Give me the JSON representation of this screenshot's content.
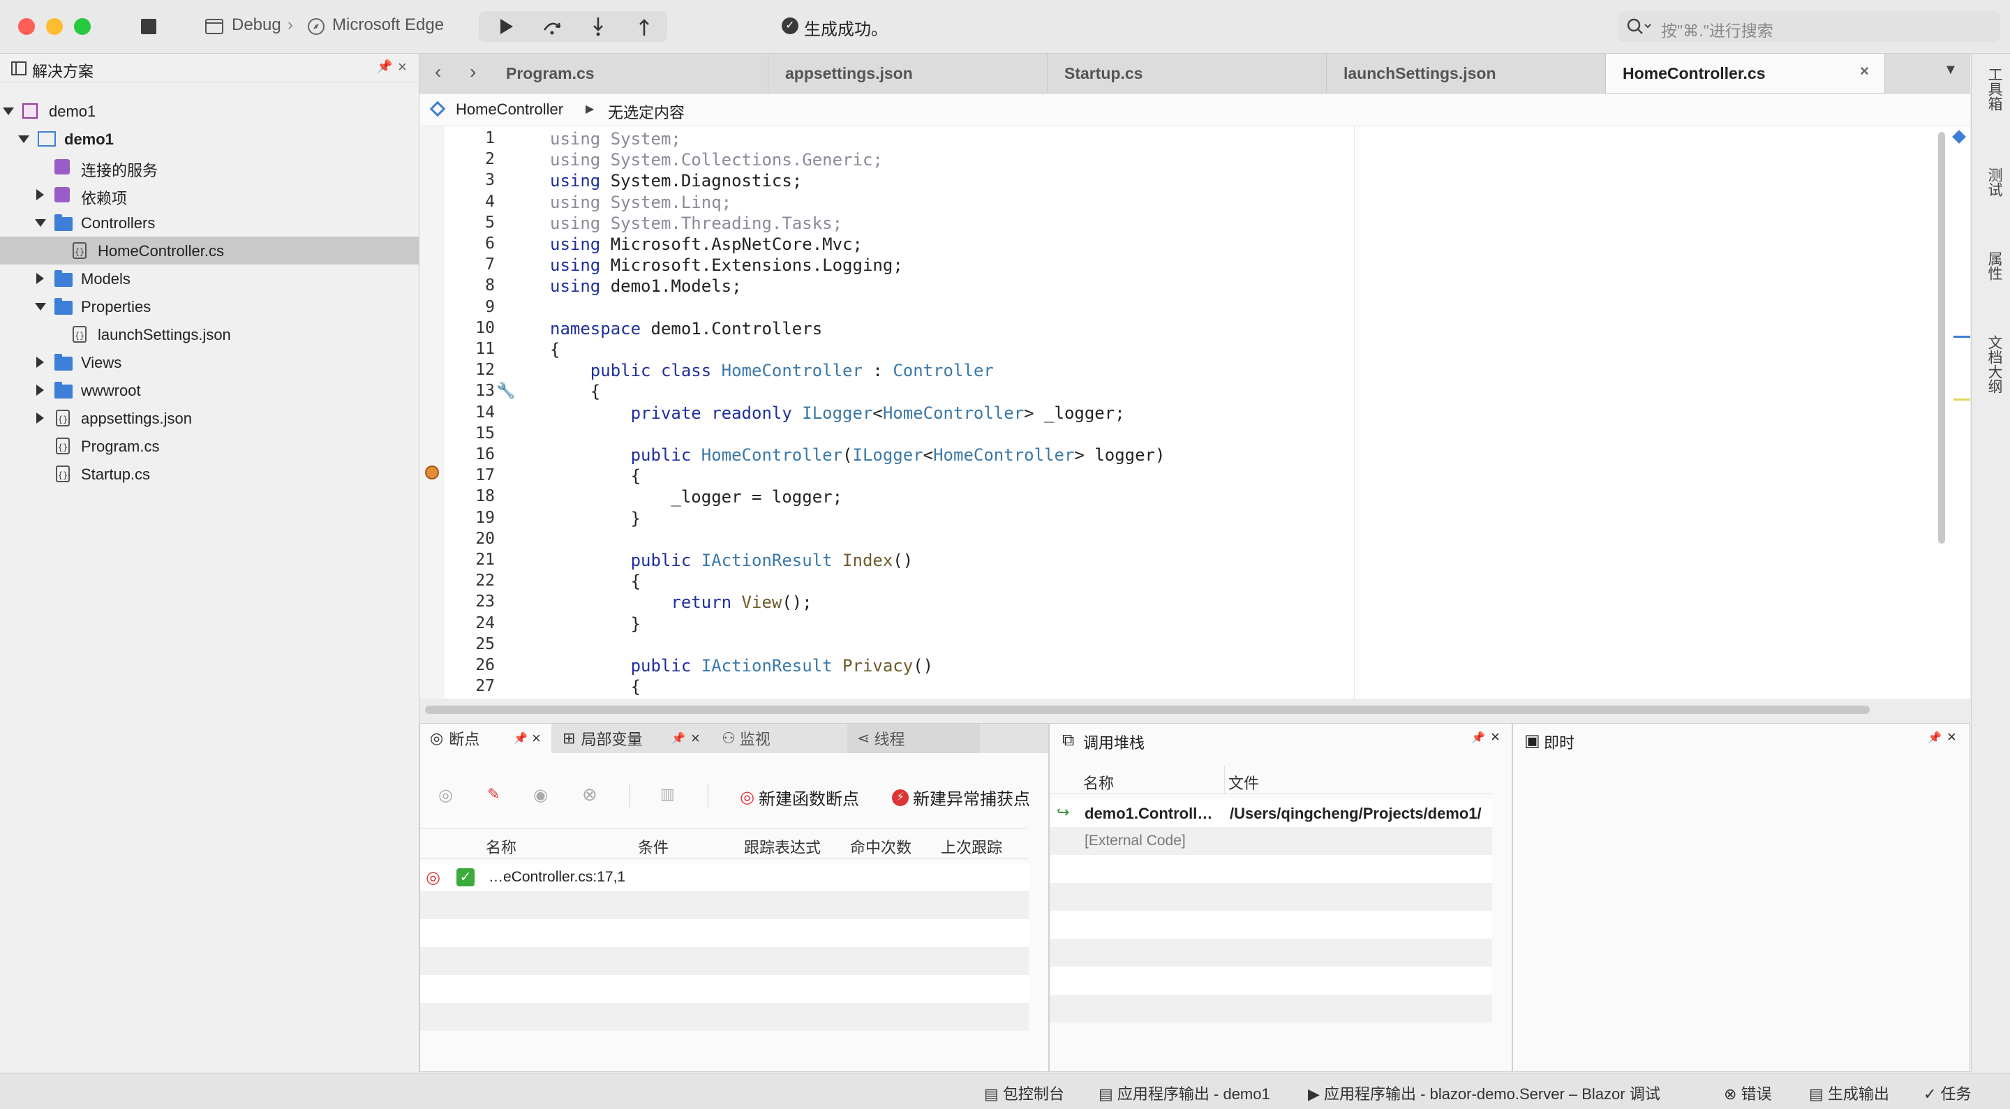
{
  "titlebar": {
    "config": "Debug",
    "target": "Microsoft Edge",
    "status": "生成成功。",
    "search_placeholder": "按\"⌘.\"进行搜索"
  },
  "solution": {
    "title": "解决方案",
    "items": [
      {
        "label": "demo1"
      },
      {
        "label": "demo1"
      },
      {
        "label": "连接的服务"
      },
      {
        "label": "依赖项"
      },
      {
        "label": "Controllers"
      },
      {
        "label": "HomeController.cs"
      },
      {
        "label": "Models"
      },
      {
        "label": "Properties"
      },
      {
        "label": "launchSettings.json"
      },
      {
        "label": "Views"
      },
      {
        "label": "wwwroot"
      },
      {
        "label": "appsettings.json"
      },
      {
        "label": "Program.cs"
      },
      {
        "label": "Startup.cs"
      }
    ]
  },
  "tabs": [
    {
      "label": "Program.cs"
    },
    {
      "label": "appsettings.json"
    },
    {
      "label": "Startup.cs"
    },
    {
      "label": "launchSettings.json"
    },
    {
      "label": "HomeController.cs"
    }
  ],
  "breadcrumb": {
    "class": "HomeController",
    "member": "无选定内容"
  },
  "code": {
    "line_numbers": [
      "1",
      "2",
      "3",
      "4",
      "5",
      "6",
      "7",
      "8",
      "9",
      "10",
      "11",
      "12",
      "13",
      "14",
      "15",
      "16",
      "17",
      "18",
      "19",
      "20",
      "21",
      "22",
      "23",
      "24",
      "25",
      "26",
      "27"
    ],
    "lines": [
      "using System;",
      "using System.Collections.Generic;",
      "using System.Diagnostics;",
      "using System.Linq;",
      "using System.Threading.Tasks;",
      "using Microsoft.AspNetCore.Mvc;",
      "using Microsoft.Extensions.Logging;",
      "using demo1.Models;",
      "",
      "namespace demo1.Controllers",
      "{",
      "    public class HomeController : Controller",
      "    {",
      "        private readonly ILogger<HomeController> _logger;",
      "",
      "        public HomeController(ILogger<HomeController> logger)",
      "        {",
      "            _logger = logger;",
      "        }",
      "",
      "        public IActionResult Index()",
      "        {",
      "            return View();",
      "        }",
      "",
      "        public IActionResult Privacy()",
      "        {"
    ]
  },
  "breakpoints_panel": {
    "tabs": [
      "断点",
      "局部变量",
      "监视",
      "线程"
    ],
    "new_function_bp": "新建函数断点",
    "new_exception_bp": "新建异常捕获点",
    "columns": [
      "名称",
      "条件",
      "跟踪表达式",
      "命中次数",
      "上次跟踪"
    ],
    "rows": [
      {
        "name": "…eController.cs:17,1"
      }
    ]
  },
  "callstack_panel": {
    "title": "调用堆栈",
    "columns": [
      "名称",
      "文件"
    ],
    "rows": [
      {
        "name": "demo1.Controll…",
        "file": "/Users/qingcheng/Projects/demo1/"
      },
      {
        "name": "[External Code]",
        "file": ""
      }
    ]
  },
  "immediate_panel": {
    "title": "即时"
  },
  "right_toolbar": [
    "工具箱",
    "测试",
    "属性",
    "文档大纲"
  ],
  "statusbar": {
    "items": [
      "包控制台",
      "应用程序输出 - demo1",
      "应用程序输出 - blazor-demo.Server – Blazor 调试",
      "错误",
      "生成输出",
      "任务"
    ]
  },
  "colors": {
    "accent": "#3d7fd6",
    "keyword": "#1f2fa0",
    "type": "#3a78a8",
    "success": "#3bab3b"
  }
}
